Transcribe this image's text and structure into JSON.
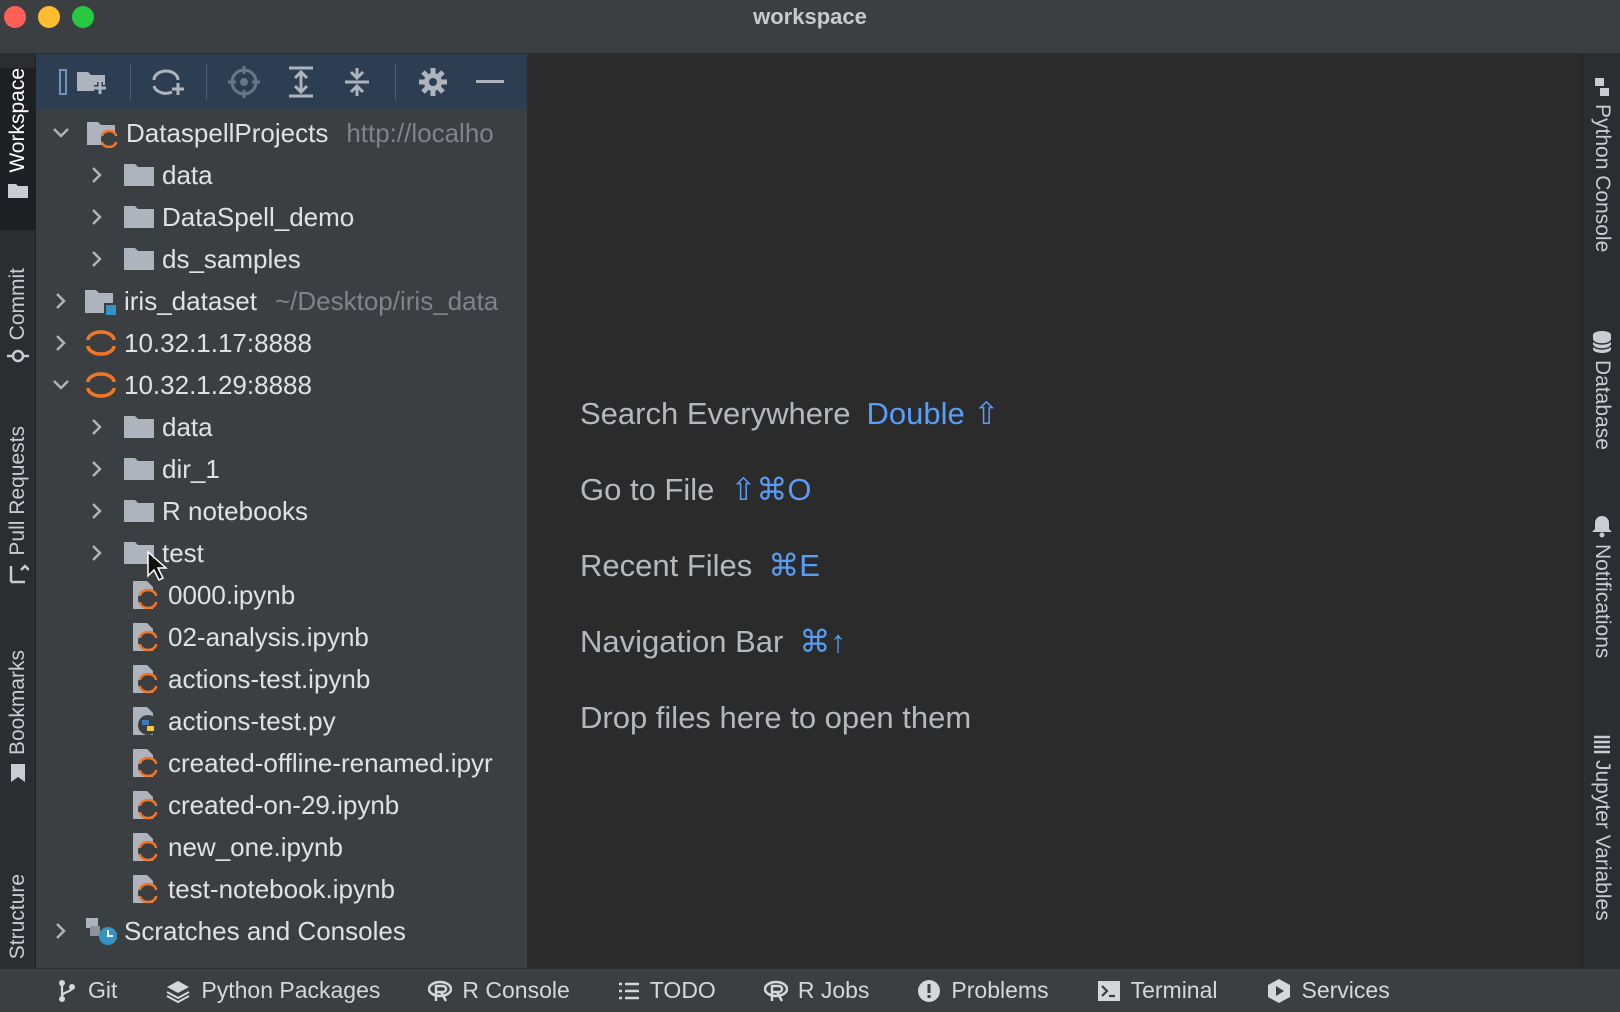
{
  "window": {
    "title": "workspace"
  },
  "left_tabs": [
    "Workspace",
    "Commit",
    "Pull Requests",
    "Bookmarks",
    "Structure"
  ],
  "right_tabs": [
    "Python Console",
    "Database",
    "Notifications",
    "Jupyter Variables"
  ],
  "tree": [
    {
      "label": "DataspellProjects",
      "hint": "http://localho",
      "level": 0,
      "expanded": true,
      "icon": "project-jupyter-icon"
    },
    {
      "label": "data",
      "level": 1,
      "expanded": false,
      "icon": "folder-icon"
    },
    {
      "label": "DataSpell_demo",
      "level": 1,
      "expanded": false,
      "icon": "folder-icon"
    },
    {
      "label": "ds_samples",
      "level": 1,
      "expanded": false,
      "icon": "folder-icon"
    },
    {
      "label": "iris_dataset",
      "hint": "~/Desktop/iris_data",
      "level": 0,
      "expanded": false,
      "icon": "project-local-icon"
    },
    {
      "label": "10.32.1.17:8888",
      "level": 0,
      "expanded": false,
      "icon": "jupyter-server-icon"
    },
    {
      "label": "10.32.1.29:8888",
      "level": 0,
      "expanded": true,
      "icon": "jupyter-server-icon"
    },
    {
      "label": "data",
      "level": 1,
      "expanded": false,
      "icon": "folder-icon"
    },
    {
      "label": "dir_1",
      "level": 1,
      "expanded": false,
      "icon": "folder-icon"
    },
    {
      "label": "R notebooks",
      "level": 1,
      "expanded": false,
      "icon": "folder-icon"
    },
    {
      "label": "test",
      "level": 1,
      "expanded": false,
      "icon": "folder-icon"
    },
    {
      "label": "0000.ipynb",
      "level": 2,
      "icon": "notebook-icon"
    },
    {
      "label": "02-analysis.ipynb",
      "level": 2,
      "icon": "notebook-icon"
    },
    {
      "label": "actions-test.ipynb",
      "level": 2,
      "icon": "notebook-icon"
    },
    {
      "label": "actions-test.py",
      "level": 2,
      "icon": "python-file-icon"
    },
    {
      "label": "created-offline-renamed.ipyr",
      "level": 2,
      "icon": "notebook-icon"
    },
    {
      "label": "created-on-29.ipynb",
      "level": 2,
      "icon": "notebook-icon"
    },
    {
      "label": "new_one.ipynb",
      "level": 2,
      "icon": "notebook-icon"
    },
    {
      "label": "test-notebook.ipynb",
      "level": 2,
      "icon": "notebook-icon"
    },
    {
      "label": "Scratches and Consoles",
      "level": 0,
      "expanded": false,
      "icon": "scratches-icon"
    }
  ],
  "editor_hints": [
    {
      "text": "Search Everywhere",
      "shortcut": "Double ⇧"
    },
    {
      "text": "Go to File",
      "shortcut": "⇧⌘O"
    },
    {
      "text": "Recent Files",
      "shortcut": "⌘E"
    },
    {
      "text": "Navigation Bar",
      "shortcut": "⌘↑"
    },
    {
      "text": "Drop files here to open them",
      "shortcut": ""
    }
  ],
  "bottom_bar": [
    "Git",
    "Python Packages",
    "R Console",
    "TODO",
    "R Jobs",
    "Problems",
    "Terminal",
    "Services"
  ],
  "colors": {
    "accent": "#589df6",
    "jupyter_orange": "#f37626",
    "panel": "#3c3f41",
    "editor": "#2b2b2b"
  }
}
